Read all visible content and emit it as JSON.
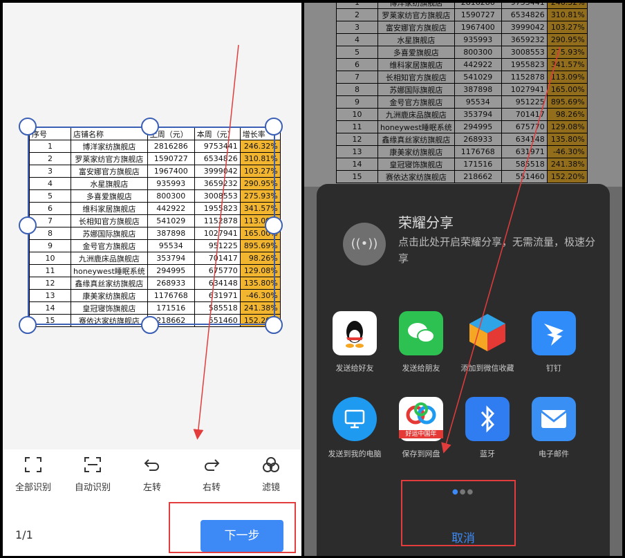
{
  "sheet": {
    "headers": [
      "序号",
      "店铺名称",
      "上周（元）",
      "本周（元）",
      "增长率"
    ],
    "rows": [
      [
        "1",
        "博洋家纺旗舰店",
        "2816286",
        "9753441",
        "246.32%"
      ],
      [
        "2",
        "罗莱家纺官方旗舰店",
        "1590727",
        "6534826",
        "310.81%"
      ],
      [
        "3",
        "富安娜官方旗舰店",
        "1967400",
        "3999042",
        "103.27%"
      ],
      [
        "4",
        "水星旗舰店",
        "935993",
        "3659232",
        "290.95%"
      ],
      [
        "5",
        "多喜爱旗舰店",
        "800300",
        "3008553",
        "275.93%"
      ],
      [
        "6",
        "维科家居旗舰店",
        "442922",
        "1955823",
        "341.57%"
      ],
      [
        "7",
        "长相知官方旗舰店",
        "541029",
        "1152878",
        "113.09%"
      ],
      [
        "8",
        "苏娜国际旗舰店",
        "387898",
        "1027941",
        "165.00%"
      ],
      [
        "9",
        "金号官方旗舰店",
        "95534",
        "951225",
        "895.69%"
      ],
      [
        "10",
        "九洲鹿床品旗舰店",
        "353794",
        "701417",
        "98.26%"
      ],
      [
        "11",
        "honeywest睡眠系统",
        "294995",
        "675770",
        "129.08%"
      ],
      [
        "12",
        "鑫缘真丝家纺旗舰店",
        "268933",
        "634148",
        "135.80%"
      ],
      [
        "13",
        "康美家纺旗舰店",
        "1176768",
        "631971",
        "-46.30%"
      ],
      [
        "14",
        "皇冠寝饰旗舰店",
        "171516",
        "585518",
        "241.38%"
      ],
      [
        "15",
        "赛依达家纺旗舰店",
        "218662",
        "551460",
        "152.20%"
      ]
    ]
  },
  "toolbar": {
    "items": [
      {
        "label": "全部识别",
        "icon": "scan-all-icon"
      },
      {
        "label": "自动识别",
        "icon": "auto-detect-icon"
      },
      {
        "label": "左转",
        "icon": "rotate-left-icon"
      },
      {
        "label": "右转",
        "icon": "rotate-right-icon"
      },
      {
        "label": "滤镜",
        "icon": "filter-icon"
      }
    ]
  },
  "pager": "1/1",
  "next_label": "下一步",
  "share": {
    "title": "荣耀分享",
    "desc": "点击此处开启荣耀分享，无需流量，极速分享",
    "apps_row1": [
      {
        "label": "发送给好友",
        "icon": "qq-icon",
        "color": "#ffffff"
      },
      {
        "label": "发送给朋友",
        "icon": "wechat-icon",
        "color": "#2dc152"
      },
      {
        "label": "添加到微信收藏",
        "icon": "wechat-favorites-icon",
        "color": "#f5a623"
      },
      {
        "label": "钉钉",
        "icon": "dingtalk-icon",
        "color": "#2f8cf8"
      }
    ],
    "apps_row2": [
      {
        "label": "发送到我的电脑",
        "icon": "computer-icon",
        "color": "#1e9af0"
      },
      {
        "label": "保存到网盘",
        "icon": "netdisk-icon",
        "color": "#ffffff",
        "badge": "好运中国年"
      },
      {
        "label": "蓝牙",
        "icon": "bluetooth-icon",
        "color": "#2f7df0"
      },
      {
        "label": "电子邮件",
        "icon": "email-icon",
        "color": "#3a8ff5"
      }
    ],
    "cancel_label": "取消"
  },
  "colors": {
    "accent": "#3d8af7",
    "highlight": "#f2b52f",
    "annotation": "#e23c3c"
  }
}
